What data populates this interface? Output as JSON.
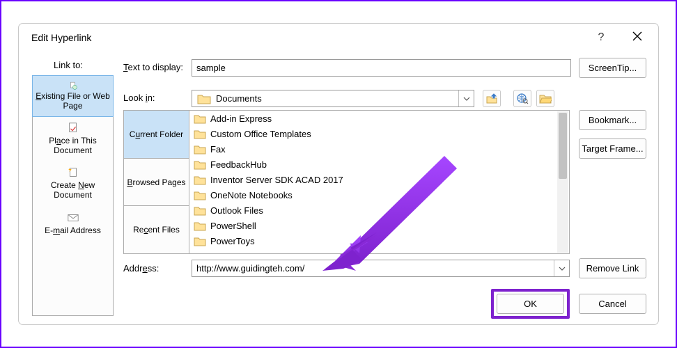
{
  "dialog": {
    "title": "Edit Hyperlink",
    "help_tooltip": "?",
    "link_to_label": "Link to:"
  },
  "link_to": {
    "items": [
      {
        "id": "existing-file",
        "label_pre": "E",
        "label_post": "xisting File or Web Page",
        "active": true
      },
      {
        "id": "this-document",
        "label_pre": "Pl",
        "label_mid": "a",
        "label_post": "ce in This Document",
        "active": false
      },
      {
        "id": "new-document",
        "label_pre": "Create ",
        "label_mid": "N",
        "label_post": "ew Document",
        "active": false
      },
      {
        "id": "email-address",
        "label_pre": "E-",
        "label_mid": "m",
        "label_post": "ail Address",
        "active": false
      }
    ]
  },
  "text_to_display": {
    "label_pre": "T",
    "label_post": "ext to display:",
    "value": "sample"
  },
  "screentip_label": "ScreenTip...",
  "look_in": {
    "label_pre": "Look ",
    "label_mid": "i",
    "label_post": "n:",
    "value": "Documents"
  },
  "browse_tabs": {
    "current": {
      "pre": "C",
      "mid": "u",
      "post": "rrent Folder"
    },
    "browsed": {
      "pre": "",
      "mid": "B",
      "post": "rowsed Pages"
    },
    "recent": {
      "pre": "Re",
      "mid": "c",
      "post": "ent Files"
    }
  },
  "files": [
    "Add-in Express",
    "Custom Office Templates",
    "Fax",
    "FeedbackHub",
    "Inventor Server SDK ACAD 2017",
    "OneNote Notebooks",
    "Outlook Files",
    "PowerShell",
    "PowerToys"
  ],
  "address": {
    "label_pre": "Addr",
    "label_mid": "e",
    "label_post": "ss:",
    "value": "http://www.guidingteh.com/"
  },
  "buttons": {
    "bookmark": "Bookmark...",
    "target_frame": "Target Frame...",
    "remove_link": "Remove Link",
    "ok": "OK",
    "cancel": "Cancel"
  }
}
